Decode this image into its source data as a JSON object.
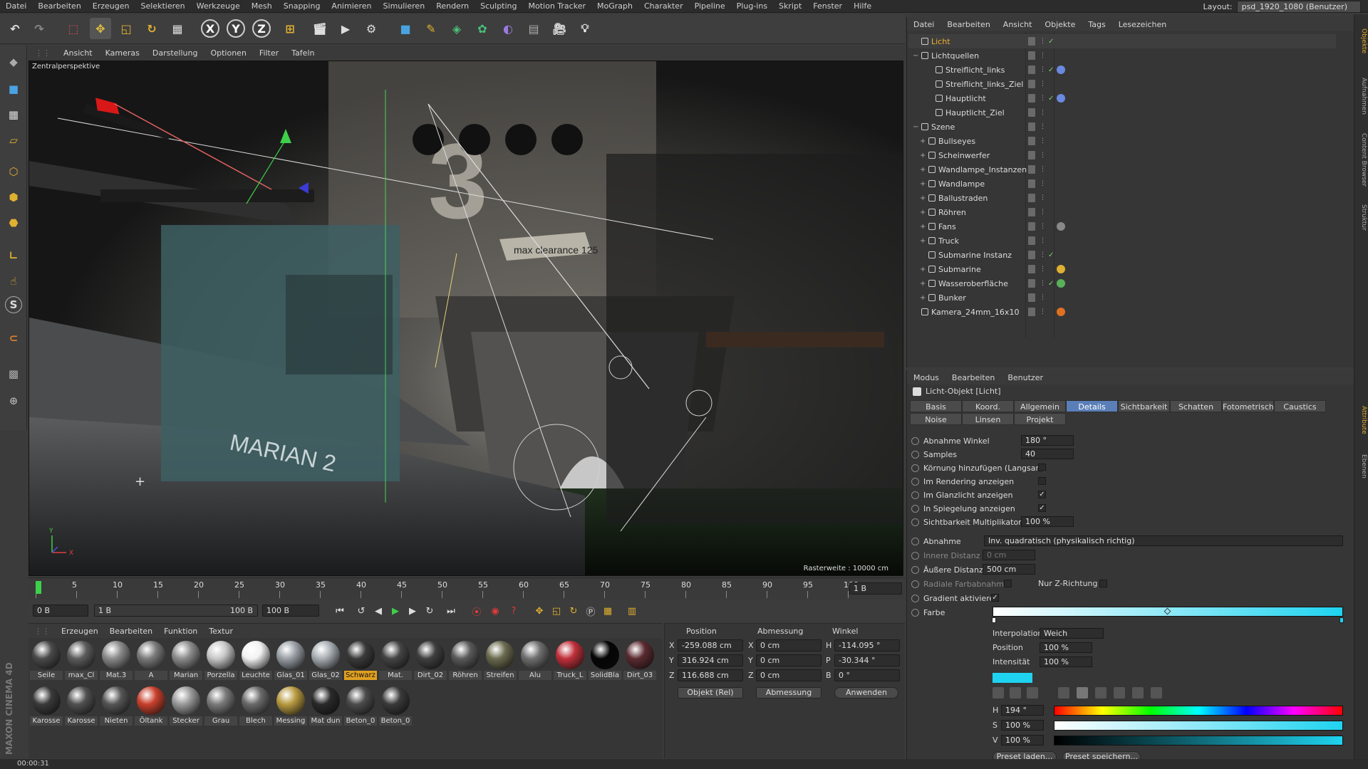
{
  "menubar": {
    "items": [
      "Datei",
      "Bearbeiten",
      "Erzeugen",
      "Selektieren",
      "Werkzeuge",
      "Mesh",
      "Snapping",
      "Animieren",
      "Simulieren",
      "Rendern",
      "Sculpting",
      "Motion Tracker",
      "MoGraph",
      "Charakter",
      "Pipeline",
      "Plug-ins",
      "Skript",
      "Fenster",
      "Hilfe"
    ],
    "layout_label": "Layout:",
    "layout_value": "psd_1920_1080 (Benutzer)"
  },
  "toolbar": {
    "icons": [
      "undo-icon",
      "redo-icon",
      "live-select-icon",
      "move-icon",
      "scale-icon",
      "rotate-icon",
      "recent-tools-icon",
      "x-axis-icon",
      "y-axis-icon",
      "z-axis-icon",
      "coordinate-system-icon",
      "render-view-icon",
      "render-picture-queue-icon",
      "render-settings-icon",
      "cube-primitive-icon",
      "pen-spline-icon",
      "subdivision-icon",
      "cloner-icon",
      "deformer-icon",
      "floor-scene-icon",
      "camera-icon",
      "light-icon"
    ],
    "axis_labels": [
      "X",
      "Y",
      "Z"
    ]
  },
  "viewport": {
    "menu": [
      "Ansicht",
      "Kameras",
      "Darstellung",
      "Optionen",
      "Filter",
      "Tafeln"
    ],
    "camera_label": "Zentralperspektive",
    "grid_info": "Rasterweite : 10000 cm",
    "scene_texts": {
      "hull": "MARIAN 2",
      "sign": "max clearance 125"
    },
    "axis_labels": {
      "y": "Y",
      "x": "X",
      "z": "Z"
    }
  },
  "timeline": {
    "ticks": [
      "0",
      "5",
      "10",
      "15",
      "20",
      "25",
      "30",
      "35",
      "40",
      "45",
      "50",
      "55",
      "60",
      "65",
      "70",
      "75",
      "80",
      "85",
      "90",
      "95",
      "100"
    ],
    "current_frame_field": "1 B"
  },
  "playbar": {
    "start_field": "0 B",
    "range_start": "1 B",
    "range_end": "100 B",
    "end_field": "100 B"
  },
  "materials": {
    "menu": [
      "Erzeugen",
      "Bearbeiten",
      "Funktion",
      "Textur"
    ],
    "row1": [
      {
        "name": "Seile",
        "color": "#4a4a4a"
      },
      {
        "name": "max_Cl",
        "color": "#5c5c5c"
      },
      {
        "name": "Mat.3",
        "color": "#8a8a8a"
      },
      {
        "name": "A",
        "color": "#7a7a7a"
      },
      {
        "name": "Marian",
        "color": "#8c8c8c"
      },
      {
        "name": "Porzella",
        "color": "#c8c8c8"
      },
      {
        "name": "Leuchte",
        "color": "#f2f2f2"
      },
      {
        "name": "Glas_01",
        "color": "#9aa0a6"
      },
      {
        "name": "Glas_02",
        "color": "#a8aeb3"
      },
      {
        "name": "Schwarz",
        "color": "#3a3a3a",
        "selected": true
      },
      {
        "name": "Mat.",
        "color": "#444444"
      },
      {
        "name": "Dirt_02",
        "color": "#3f3f3f"
      },
      {
        "name": "Röhren",
        "color": "#5a5a5a"
      },
      {
        "name": "Streifen",
        "color": "#6b6b4f"
      },
      {
        "name": "Alu",
        "color": "#6f6f6f"
      },
      {
        "name": "Truck_L",
        "color": "#c0303a"
      },
      {
        "name": "SolidBla",
        "color": "#050505"
      },
      {
        "name": "Dirt_03",
        "color": "#5a2a30"
      }
    ],
    "row2": [
      {
        "name": "Karosse",
        "color": "#3a3a3a"
      },
      {
        "name": "Karosse",
        "color": "#505050"
      },
      {
        "name": "Nieten",
        "color": "#555555"
      },
      {
        "name": "Öltank",
        "color": "#c8402c"
      },
      {
        "name": "Stecker",
        "color": "#9a9a9a"
      },
      {
        "name": "Grau",
        "color": "#7a7a7a"
      },
      {
        "name": "Blech",
        "color": "#6a6a6a"
      },
      {
        "name": "Messing",
        "color": "#b89a40"
      },
      {
        "name": "Mat dun",
        "color": "#2a2a2a"
      },
      {
        "name": "Beton_0",
        "color": "#4c4c4c"
      },
      {
        "name": "Beton_0",
        "color": "#3a3a3a"
      }
    ]
  },
  "coordinates": {
    "headers": {
      "position": "Position",
      "size": "Abmessung",
      "angle": "Winkel"
    },
    "rows": [
      {
        "axis": "X",
        "pos": "-259.088 cm",
        "size_axis": "X",
        "size": "0 cm",
        "ang_axis": "H",
        "ang": "-114.095 °"
      },
      {
        "axis": "Y",
        "pos": "316.924 cm",
        "size_axis": "Y",
        "size": "0 cm",
        "ang_axis": "P",
        "ang": "-30.344 °"
      },
      {
        "axis": "Z",
        "pos": "116.688 cm",
        "size_axis": "Z",
        "size": "0 cm",
        "ang_axis": "B",
        "ang": "0 °"
      }
    ],
    "mode_select": "Objekt (Rel)",
    "size_select": "Abmessung",
    "apply_button": "Anwenden"
  },
  "object_manager": {
    "menu": [
      "Datei",
      "Bearbeiten",
      "Ansicht",
      "Objekte",
      "Tags",
      "Lesezeichen"
    ],
    "rows": [
      {
        "name": "Licht",
        "indent": 0,
        "highlight": true,
        "check": true
      },
      {
        "name": "Lichtquellen",
        "indent": 0,
        "expander": "−"
      },
      {
        "name": "Streiflicht_links",
        "indent": 2,
        "check": true,
        "tag": "target"
      },
      {
        "name": "Streiflicht_links_Ziel",
        "indent": 2
      },
      {
        "name": "Hauptlicht",
        "indent": 2,
        "check": true,
        "tag": "target"
      },
      {
        "name": "Hauptlicht_Ziel",
        "indent": 2
      },
      {
        "name": "Szene",
        "indent": 0,
        "expander": "−"
      },
      {
        "name": "Bullseyes",
        "indent": 1,
        "expander": "+"
      },
      {
        "name": "Scheinwerfer",
        "indent": 1,
        "expander": "+"
      },
      {
        "name": "Wandlampe_Instanzen",
        "indent": 1,
        "expander": "+"
      },
      {
        "name": "Wandlampe",
        "indent": 1,
        "expander": "+"
      },
      {
        "name": "Ballustraden",
        "indent": 1,
        "expander": "+"
      },
      {
        "name": "Röhren",
        "indent": 1,
        "expander": "+"
      },
      {
        "name": "Fans",
        "indent": 1,
        "expander": "+",
        "tag": "sphere"
      },
      {
        "name": "Truck",
        "indent": 1,
        "expander": "+"
      },
      {
        "name": "Submarine Instanz",
        "indent": 1,
        "check": true
      },
      {
        "name": "Submarine",
        "indent": 1,
        "expander": "+",
        "tag": "lock"
      },
      {
        "name": "Wasseroberfläche",
        "indent": 1,
        "expander": "+",
        "check": true,
        "tag": "water"
      },
      {
        "name": "Bunker",
        "indent": 1,
        "expander": "+"
      },
      {
        "name": "Kamera_24mm_16x10",
        "indent": 0,
        "tag": "forbid"
      }
    ]
  },
  "attributes": {
    "menu": [
      "Modus",
      "Bearbeiten",
      "Benutzer"
    ],
    "object_title": "Licht-Objekt [Licht]",
    "tabs_row1": [
      "Basis",
      "Koord.",
      "Allgemein",
      "Details",
      "Sichtbarkeit",
      "Schatten",
      "Fotometrisch",
      "Caustics"
    ],
    "tabs_row2": [
      "Noise",
      "Linsen",
      "Projekt"
    ],
    "active_tab": "Details",
    "params": {
      "abnahme_winkel": {
        "label": "Abnahme Winkel",
        "value": "180 °"
      },
      "samples": {
        "label": "Samples",
        "value": "40"
      },
      "koernung": {
        "label": "Körnung hinzufügen (Langsam)",
        "checked": false
      },
      "im_rendering": {
        "label": "Im Rendering anzeigen",
        "checked": false
      },
      "im_glanzlicht": {
        "label": "Im Glanzlicht anzeigen",
        "checked": true
      },
      "in_spiegelung": {
        "label": "In Spiegelung anzeigen",
        "checked": true
      },
      "sichtbarkeit_mult": {
        "label": "Sichtbarkeit Multiplikator",
        "value": "100 %"
      },
      "abnahme": {
        "label": "Abnahme",
        "value": "Inv. quadratisch (physikalisch richtig)"
      },
      "innere_distanz": {
        "label": "Innere Distanz",
        "value": "0 cm"
      },
      "aeussere_distanz": {
        "label": "Äußere Distanz",
        "value": "500 cm"
      },
      "radiale_farbabnahme": {
        "label": "Radiale Farbabnahme",
        "checked": false
      },
      "nur_z": {
        "label": "Nur Z-Richtung",
        "checked": false
      },
      "gradient_aktiv": {
        "label": "Gradient aktivieren",
        "checked": true
      },
      "farbe": {
        "label": "Farbe"
      }
    },
    "gradient": {
      "interpolation_label": "Interpolation",
      "interpolation_value": "Weich",
      "position_label": "Position",
      "position_value": "100 %",
      "intensity_label": "Intensität",
      "intensity_value": "100 %",
      "swatch_color": "#1fd3f0"
    },
    "hsv": {
      "h_label": "H",
      "h_value": "194 °",
      "s_label": "S",
      "s_value": "100 %",
      "v_label": "V",
      "v_value": "100 %"
    },
    "preset_load": "Preset laden...",
    "preset_save": "Preset speichern..."
  },
  "right_strip_tabs": [
    "Objekte",
    "Aufnahmen",
    "Content Browser",
    "Struktur",
    "Attribute",
    "Ebenen"
  ],
  "status": {
    "time": "00:00:31"
  },
  "branding": {
    "logo": "MAXON CINEMA 4D"
  }
}
